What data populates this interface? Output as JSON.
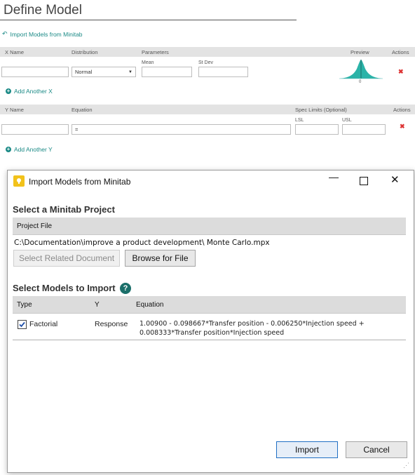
{
  "page": {
    "title": "Define Model",
    "import_link": "Import Models from Minitab"
  },
  "x_table": {
    "headers": [
      "X Name",
      "Distribution",
      "Parameters",
      "Preview",
      "Actions"
    ],
    "row": {
      "x_name": "",
      "distribution": "Normal",
      "mean_label": "Mean",
      "stdev_label": "St Dev",
      "mean": "",
      "stdev": "",
      "preview_zero": "0"
    },
    "add_label": "Add Another X"
  },
  "y_table": {
    "headers": [
      "Y Name",
      "Equation",
      "Spec Limits (Optional)",
      "Actions"
    ],
    "row": {
      "y_name": "",
      "equation": "=",
      "lsl_label": "LSL",
      "usl_label": "USL",
      "lsl": "",
      "usl": ""
    },
    "add_label": "Add Another Y"
  },
  "dialog": {
    "title": "Import Models from Minitab",
    "project_section": "Select a Minitab Project",
    "project_file_header": "Project File",
    "project_path": "C:\\Documentation\\improve a product development\\ Monte Carlo.mpx",
    "select_related_btn": "Select Related Document",
    "browse_btn": "Browse for File",
    "models_section": "Select Models to Import",
    "models_headers": [
      "Type",
      "Y",
      "Equation"
    ],
    "models": [
      {
        "checked": true,
        "type": "Factorial",
        "y": "Response",
        "equation_line1": "1.00900 - 0.098667*Transfer position - 0.006250*Injection speed +",
        "equation_line2": "0.008333*Transfer position*Injection speed"
      }
    ],
    "import_btn": "Import",
    "cancel_btn": "Cancel"
  },
  "colors": {
    "accent": "#1b8a86",
    "header_bg": "#e3e3e3",
    "danger": "#d33333",
    "primary_border": "#1f6fc4"
  }
}
